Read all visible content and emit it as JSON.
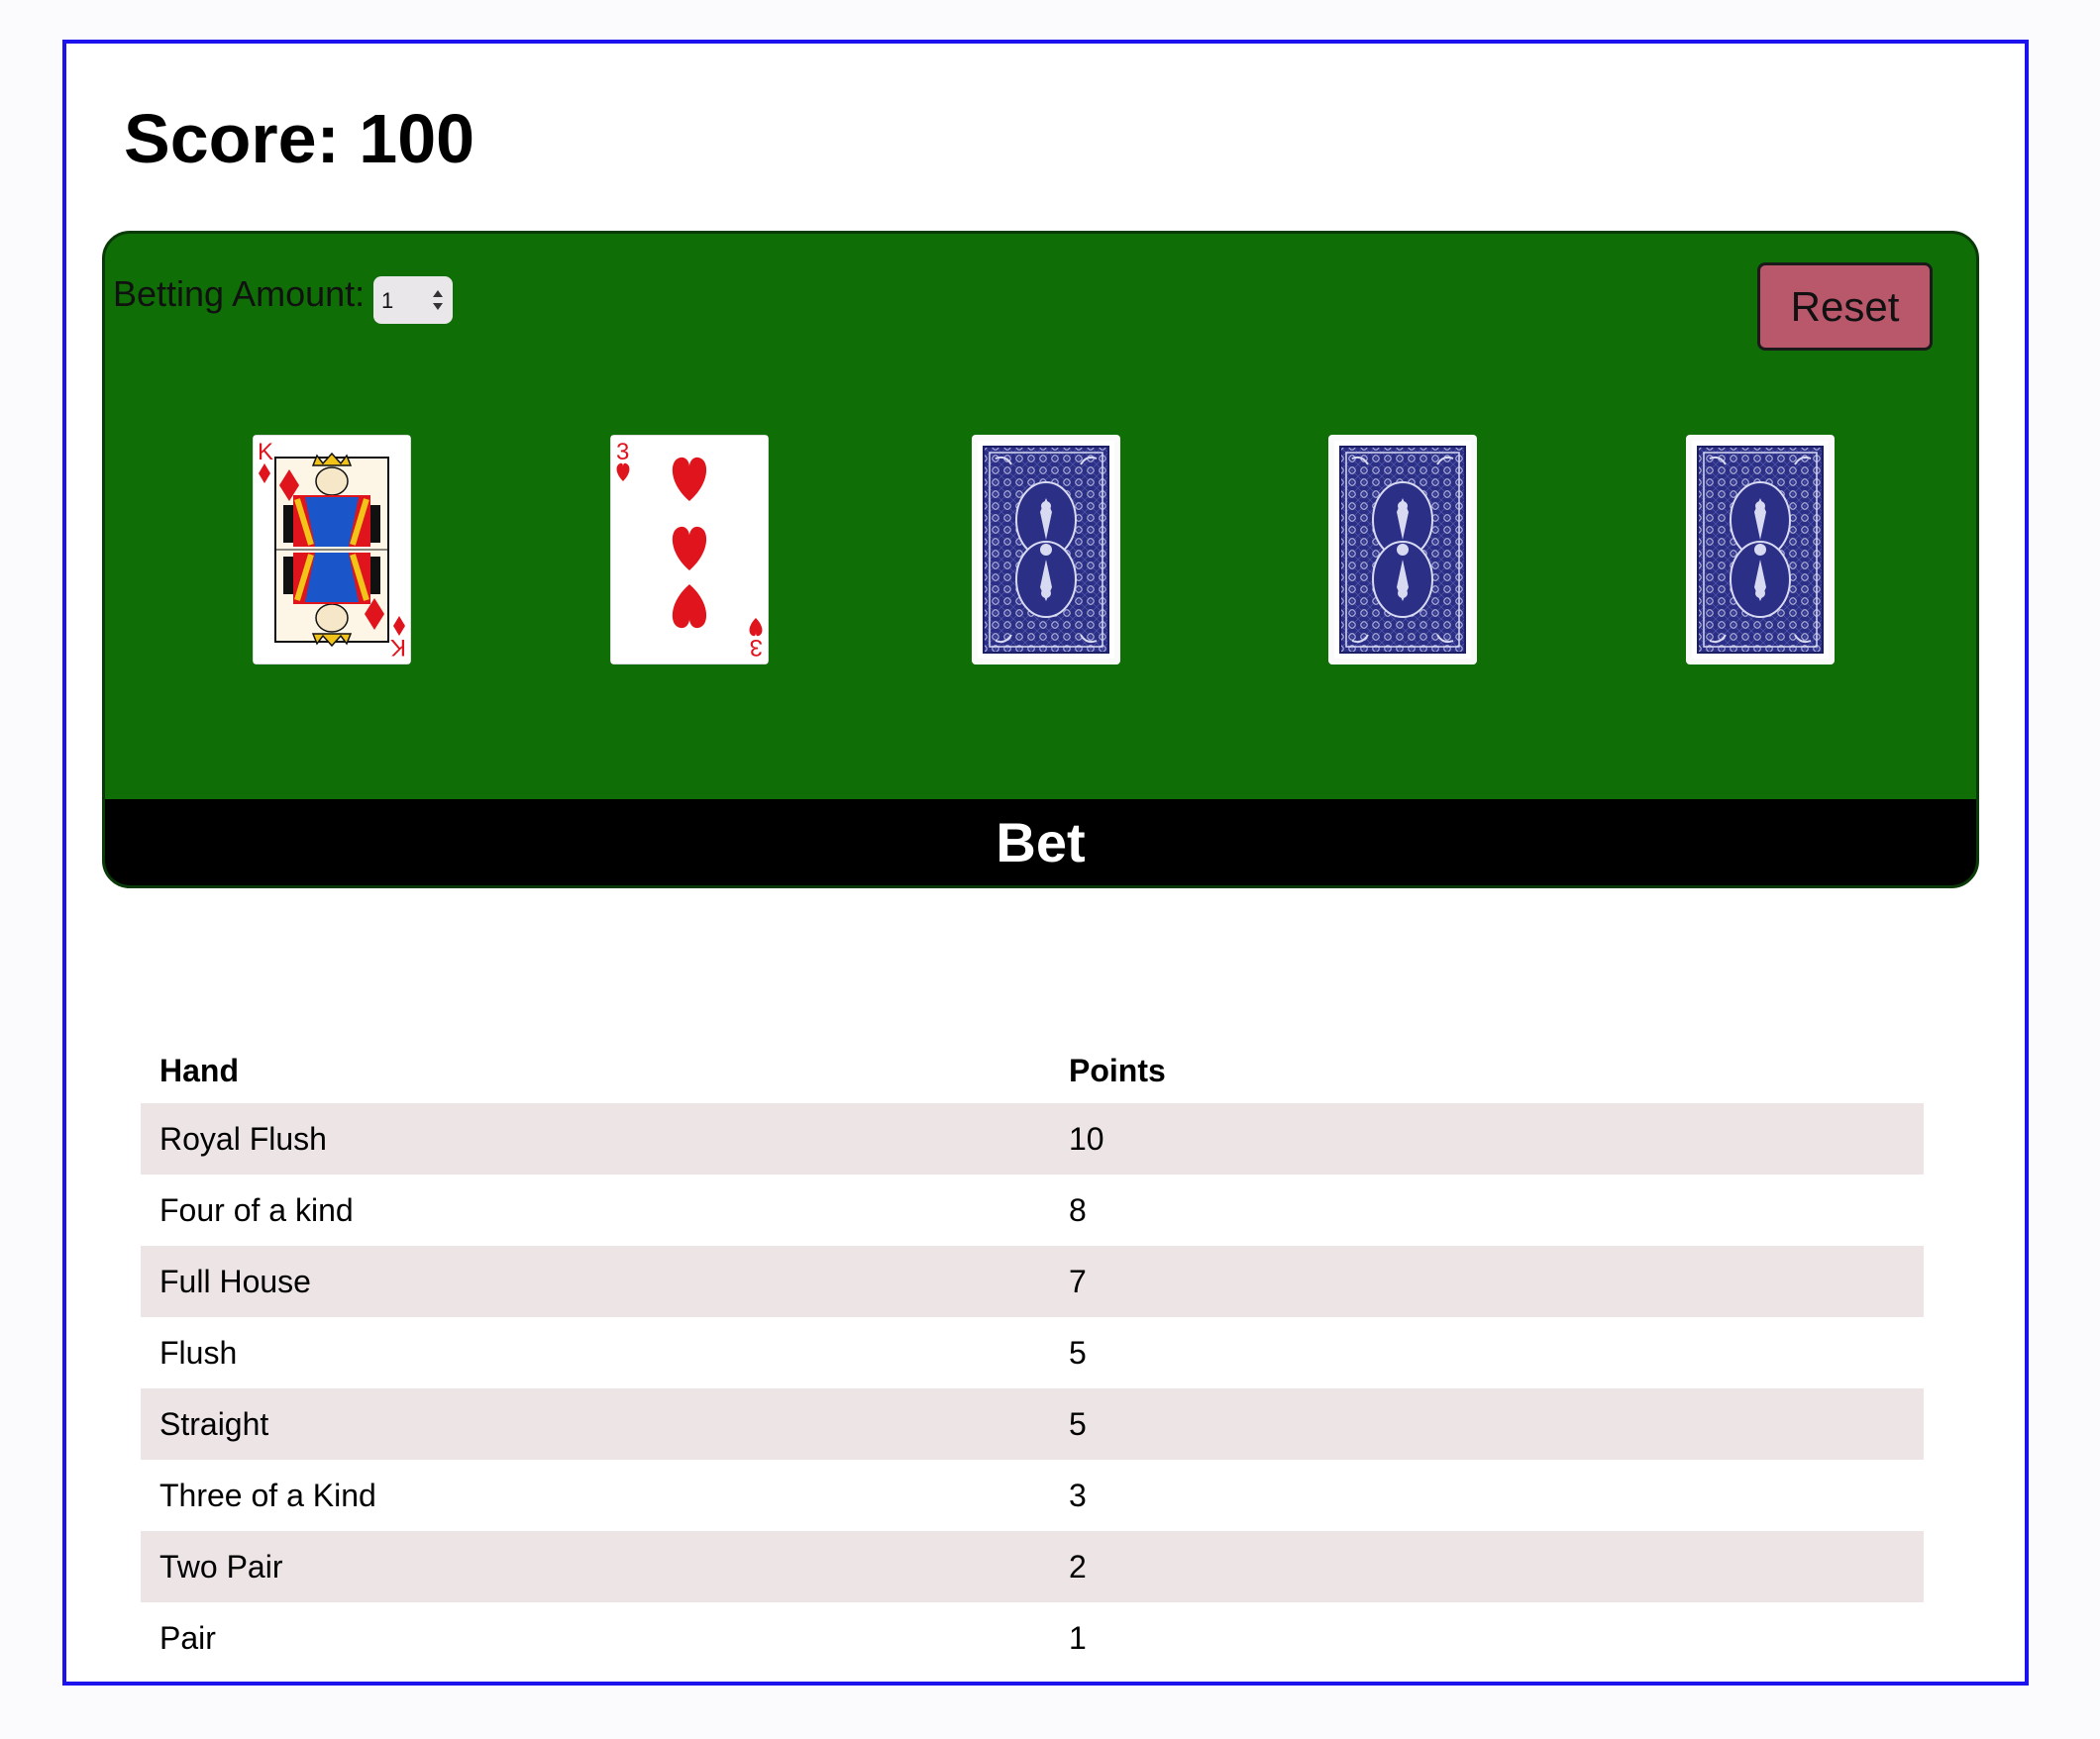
{
  "score": {
    "label": "Score: 100"
  },
  "controls": {
    "betting_label": "Betting Amount:",
    "betting_value": "1",
    "reset_label": "Reset",
    "bet_label": "Bet"
  },
  "cards": [
    {
      "state": "face-up",
      "rank": "K",
      "suit": "diamonds",
      "name": "king of diamonds"
    },
    {
      "state": "face-up",
      "rank": "3",
      "suit": "hearts",
      "name": "three of hearts"
    },
    {
      "state": "face-down"
    },
    {
      "state": "face-down"
    },
    {
      "state": "face-down"
    }
  ],
  "payouts": {
    "headers": [
      "Hand",
      "Points"
    ],
    "rows": [
      {
        "hand": "Royal Flush",
        "points": "10"
      },
      {
        "hand": "Four of a kind",
        "points": "8"
      },
      {
        "hand": "Full House",
        "points": "7"
      },
      {
        "hand": "Flush",
        "points": "5"
      },
      {
        "hand": "Straight",
        "points": "5"
      },
      {
        "hand": "Three of a Kind",
        "points": "3"
      },
      {
        "hand": "Two Pair",
        "points": "2"
      },
      {
        "hand": "Pair",
        "points": "1"
      }
    ]
  },
  "colors": {
    "frame_border": "#1b12ee",
    "felt": "#0f6f06",
    "reset_button": "#b9576b",
    "bet_bar": "#000000",
    "row_shade": "#ede4e5",
    "card_red": "#e0141c",
    "card_back_blue": "#2b2f86"
  }
}
